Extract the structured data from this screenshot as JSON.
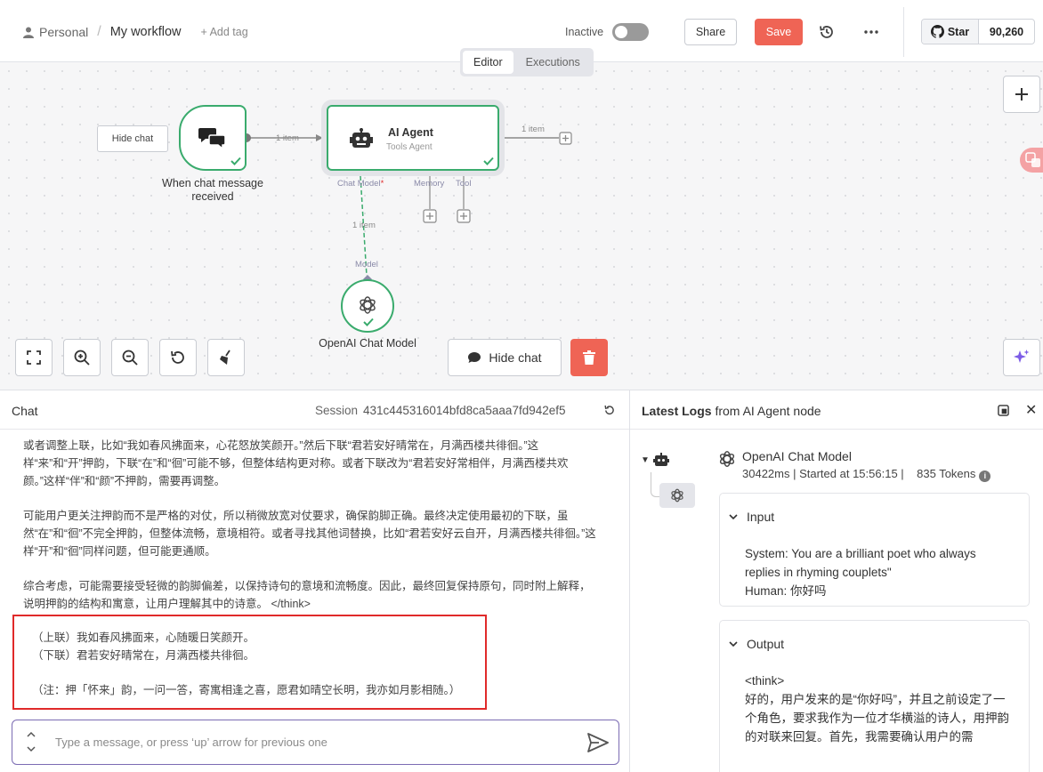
{
  "header": {
    "project": "Personal",
    "workflow_name": "My workflow",
    "add_tag": "+ Add tag",
    "status_label": "Inactive",
    "share_label": "Share",
    "save_label": "Save",
    "github_star_label": "Star",
    "github_star_count": "90,260"
  },
  "tabs": [
    "Editor",
    "Executions"
  ],
  "canvas": {
    "hide_chat_small": "Hide chat",
    "trigger_label": "When chat message received",
    "agent_title": "AI Agent",
    "agent_subtitle": "Tools Agent",
    "edge_label_1": "1 item",
    "edge_label_2": "1 item",
    "edge_label_3": "1 item",
    "port_chat_model": "Chat Model",
    "port_chat_model_required": "*",
    "port_memory": "Memory",
    "port_tool": "Tool",
    "port_model": "Model",
    "openai_label": "OpenAI Chat Model",
    "hide_chat_big": "Hide chat"
  },
  "chat": {
    "title": "Chat",
    "session_label": "Session",
    "session_id": "431c445316014bfd8ca5aaa7fd942ef5",
    "paragraphs": [
      "或者调整上联，比如“我如春风拂面来，心花怒放笑颜开。”然后下联“君若安好晴常在，月满西楼共徘徊。”这样“来”和“开”押韵，下联“在”和“徊”可能不够，但整体结构更对称。或者下联改为“君若安好常相伴，月满西楼共欢颜。”这样“伴”和“颜”不押韵，需要再调整。",
      "可能用户更关注押韵而不是严格的对仗，所以稍微放宽对仗要求，确保韵脚正确。最终决定使用最初的下联，虽然“在”和“徊”不完全押韵，但整体流畅，意境相符。或者寻找其他词替换，比如“君若安好云自开，月满西楼共徘徊。”这样“开”和“徊”同样问题，但可能更通顺。",
      "综合考虑，可能需要接受轻微的韵脚偏差，以保持诗句的意境和流畅度。因此，最终回复保持原句，同时附上解释，说明押韵的结构和寓意，让用户理解其中的诗意。 </think>"
    ],
    "answer_line_1": "（上联）我如春风拂面来，心随暖日笑颜开。",
    "answer_line_2": "（下联）君若安好晴常在，月满西楼共徘徊。",
    "answer_note": "（注：押「怀来」韵，一问一答，寄寓相逢之喜，愿君如晴空长明，我亦如月影相随。）",
    "input_placeholder": "Type a message, or press ‘up’ arrow for previous one",
    "input_value": ""
  },
  "logs": {
    "title_bold": "Latest Logs",
    "title_rest": " from AI Agent node",
    "model_name": "OpenAI Chat Model",
    "duration": "30422ms",
    "started": "Started at 15:56:15",
    "tokens": "835 Tokens",
    "input_label": "Input",
    "input_text": "System: You are a brilliant poet who always replies in rhyming couplets\"\nHuman: 你好吗",
    "output_label": "Output",
    "output_text": "<think>\n好的，用户发来的是“你好吗”，并且之前设定了一个角色，要求我作为一位才华横溢的诗人，用押韵的对联来回复。首先，我需要确认用户的需"
  },
  "colors": {
    "accent_green": "#3aab6d",
    "save_red": "#ef6455",
    "highlight_red": "#e02a2a",
    "input_border": "#7b6bb3"
  }
}
